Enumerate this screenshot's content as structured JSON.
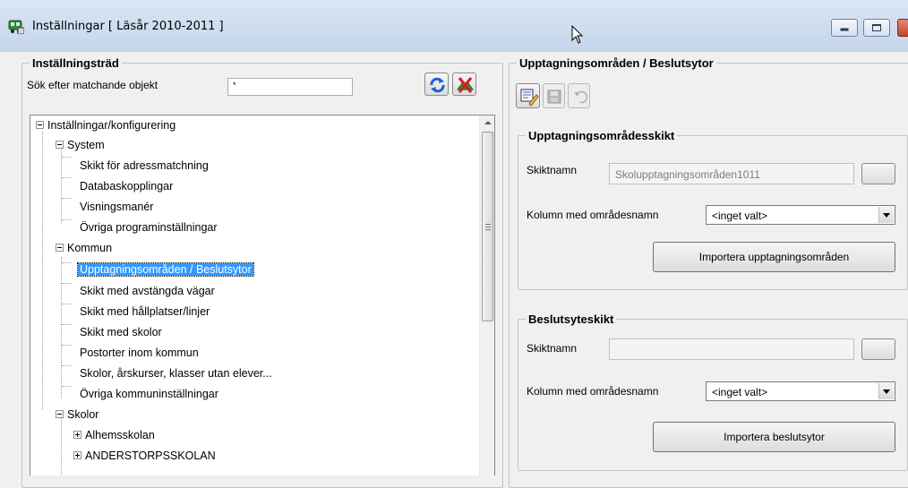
{
  "window": {
    "title": "Inställningar  [ Läsår 2010-2011 ]"
  },
  "left": {
    "group_title": "Inställningsträd",
    "search_label": "Sök efter matchande objekt",
    "search_value": "*"
  },
  "tree": {
    "items": [
      {
        "label": "Inställningar/konfigurering",
        "expander": "minus"
      },
      {
        "label": "System",
        "expander": "minus"
      },
      {
        "label": "Skikt för adressmatchning"
      },
      {
        "label": "Databaskopplingar"
      },
      {
        "label": "Visningsmanér"
      },
      {
        "label": "Övriga programinställningar"
      },
      {
        "label": "Kommun",
        "expander": "minus"
      },
      {
        "label": "Upptagningsområden / Beslutsytor",
        "selected": true
      },
      {
        "label": "Skikt med avstängda vägar"
      },
      {
        "label": "Skikt med hållplatser/linjer"
      },
      {
        "label": "Skikt med skolor"
      },
      {
        "label": "Postorter inom kommun"
      },
      {
        "label": "Skolor, årskurser, klasser utan elever..."
      },
      {
        "label": "Övriga kommuninställningar"
      },
      {
        "label": "Skolor",
        "expander": "minus"
      },
      {
        "label": "Alhemsskolan",
        "expander": "plus"
      },
      {
        "label": "ANDERSTORPSSKOLAN",
        "expander": "plus"
      }
    ]
  },
  "right": {
    "group_title": "Upptagningsområden / Beslutsytor",
    "upptag": {
      "title": "Upptagningsområdesskikt",
      "skiktnamn_label": "Skiktnamn",
      "skiktnamn_value": "Skolupptagningsområden1011",
      "kolumn_label": "Kolumn med områdesnamn",
      "kolumn_value": "<inget valt>",
      "import_button": "Importera upptagningsområden"
    },
    "beslut": {
      "title": "Beslutsyteskikt",
      "skiktnamn_label": "Skiktnamn",
      "skiktnamn_value": "",
      "kolumn_label": "Kolumn med områdesnamn",
      "kolumn_value": "<inget valt>",
      "import_button": "Importera beslutsytor"
    }
  },
  "icons": {
    "app": "bus-icon",
    "refresh": "refresh-icon",
    "clear": "clear-filter-icon",
    "edit": "edit-icon",
    "save": "save-icon",
    "undo": "undo-icon"
  }
}
